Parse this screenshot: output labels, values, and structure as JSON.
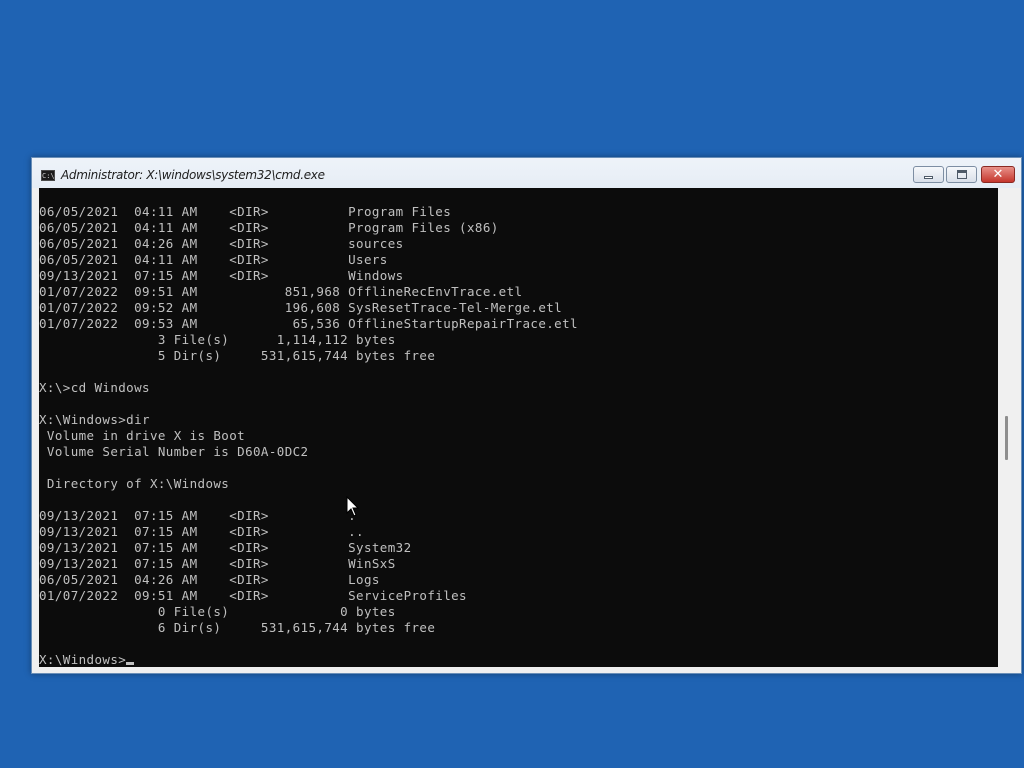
{
  "window": {
    "title": "Administrator: X:\\windows\\system32\\cmd.exe",
    "title_icon": "cmd-icon",
    "controls": {
      "minimize": "minimize-icon",
      "maximize": "restore-icon",
      "close": "close-icon",
      "close_glyph": "✕"
    }
  },
  "console": {
    "lines": [
      "06/05/2021  04:11 AM    <DIR>          Program Files",
      "06/05/2021  04:11 AM    <DIR>          Program Files (x86)",
      "06/05/2021  04:26 AM    <DIR>          sources",
      "06/05/2021  04:11 AM    <DIR>          Users",
      "09/13/2021  07:15 AM    <DIR>          Windows",
      "01/07/2022  09:51 AM           851,968 OfflineRecEnvTrace.etl",
      "01/07/2022  09:52 AM           196,608 SysResetTrace-Tel-Merge.etl",
      "01/07/2022  09:53 AM            65,536 OfflineStartupRepairTrace.etl",
      "               3 File(s)      1,114,112 bytes",
      "               5 Dir(s)     531,615,744 bytes free",
      "",
      "X:\\>cd Windows",
      "",
      "X:\\Windows>dir",
      " Volume in drive X is Boot",
      " Volume Serial Number is D60A-0DC2",
      "",
      " Directory of X:\\Windows",
      "",
      "09/13/2021  07:15 AM    <DIR>          .",
      "09/13/2021  07:15 AM    <DIR>          ..",
      "09/13/2021  07:15 AM    <DIR>          System32",
      "09/13/2021  07:15 AM    <DIR>          WinSxS",
      "06/05/2021  04:26 AM    <DIR>          Logs",
      "01/07/2022  09:51 AM    <DIR>          ServiceProfiles",
      "               0 File(s)              0 bytes",
      "               6 Dir(s)     531,615,744 bytes free",
      ""
    ],
    "prompt": "X:\\Windows>",
    "text_color": "#c0c0c0",
    "background_color": "#0c0c0c"
  },
  "desktop": {
    "background_color": "#1f63b3"
  }
}
